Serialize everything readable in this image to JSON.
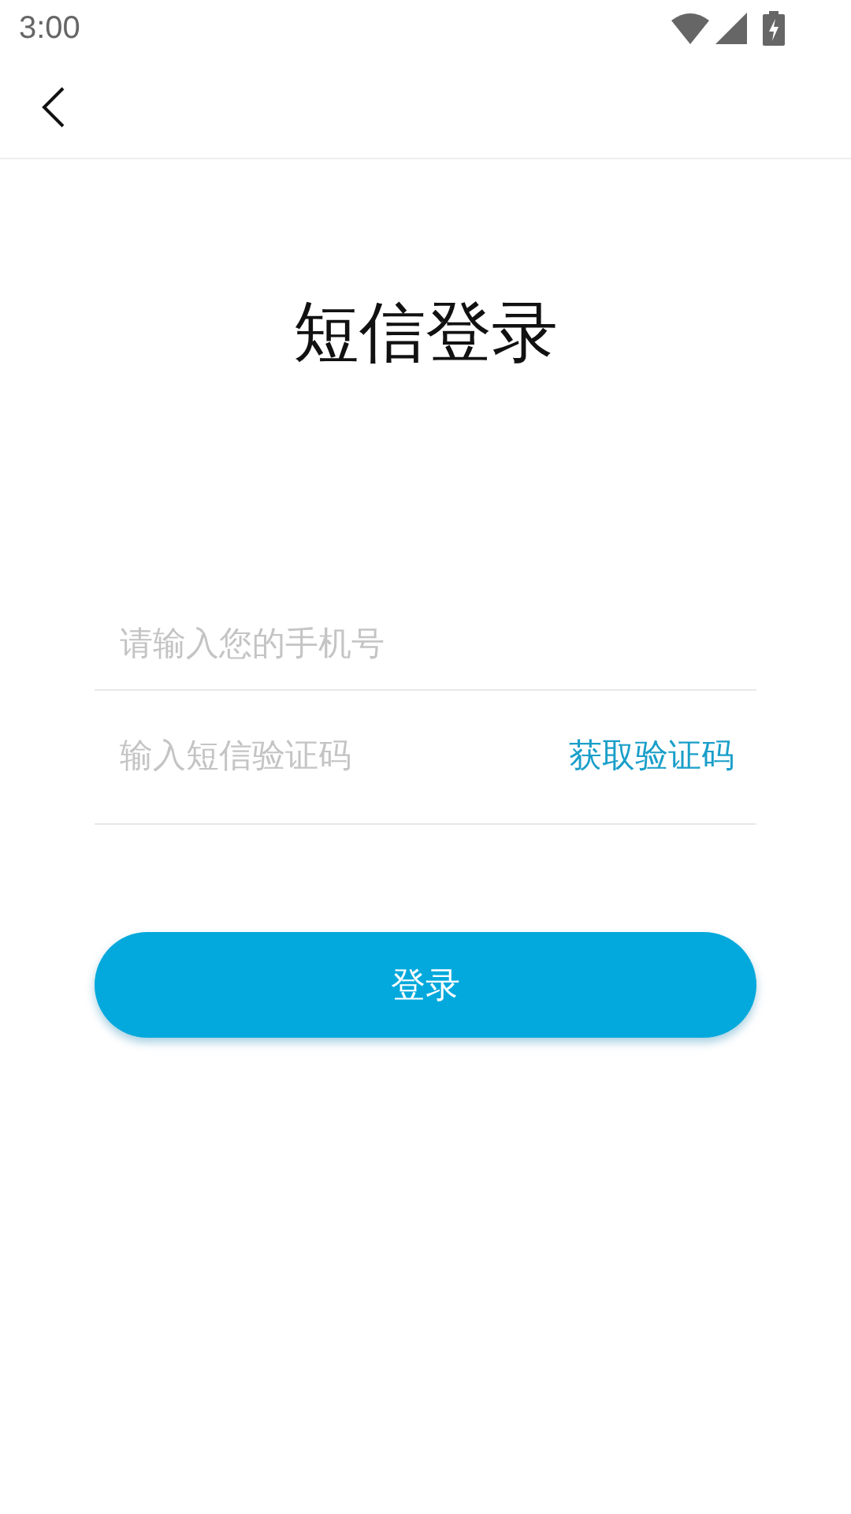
{
  "status_bar": {
    "time": "3:00"
  },
  "title": "短信登录",
  "phone_field": {
    "placeholder": "请输入您的手机号"
  },
  "code_field": {
    "placeholder": "输入短信验证码"
  },
  "get_code_link": "获取验证码",
  "login_button": "登录"
}
